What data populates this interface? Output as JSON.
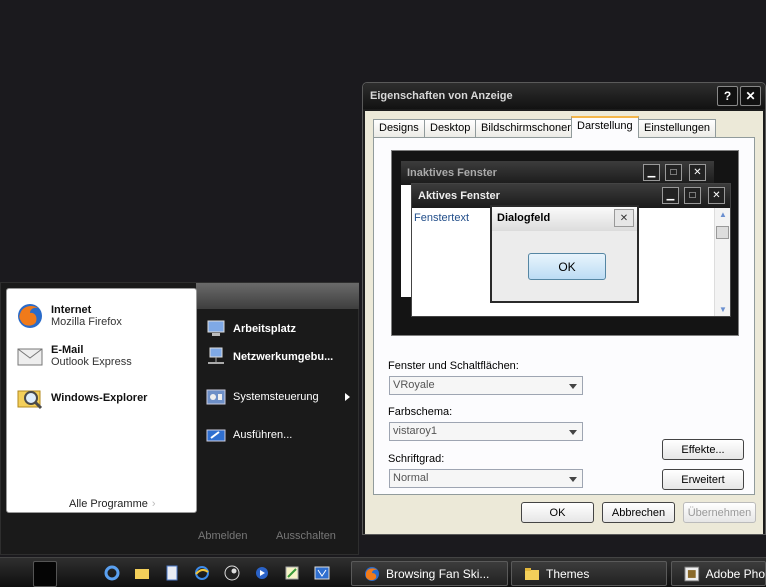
{
  "start_menu": {
    "pinned": [
      {
        "title": "Internet",
        "subtitle": "Mozilla Firefox",
        "icon": "firefox-icon"
      },
      {
        "title": "E-Mail",
        "subtitle": "Outlook Express",
        "icon": "mail-icon"
      },
      {
        "title": "Windows-Explorer",
        "subtitle": "",
        "icon": "explorer-icon"
      }
    ],
    "all_programs": "Alle Programme",
    "right_items": [
      {
        "label": "Arbeitsplatz",
        "icon": "computer-icon"
      },
      {
        "label": "Netzwerkumgebu...",
        "icon": "network-icon"
      },
      {
        "label": "Systemsteuerung",
        "icon": "control-panel-icon"
      },
      {
        "label": "Ausführen...",
        "icon": "run-icon"
      }
    ],
    "logoff": "Abmelden",
    "shutdown": "Ausschalten"
  },
  "dialog": {
    "title": "Eigenschaften von Anzeige",
    "help_btn": "?",
    "close_btn": "✕",
    "tabs": [
      "Designs",
      "Desktop",
      "Bildschirmschoner",
      "Darstellung",
      "Einstellungen"
    ],
    "active_tab": "Darstellung",
    "preview": {
      "inactive_title": "Inaktives Fenster",
      "active_title": "Aktives Fenster",
      "window_text": "Fenstertext",
      "msgbox_title": "Dialogfeld",
      "msgbox_ok": "OK"
    },
    "fields": {
      "windows_label": "Fenster und Schaltflächen:",
      "windows_value": "VRoyale",
      "scheme_label": "Farbschema:",
      "scheme_value": "vistaroy1",
      "font_label": "Schriftgrad:",
      "font_value": "Normal"
    },
    "effects_btn": "Effekte...",
    "advanced_btn": "Erweitert",
    "ok_btn": "OK",
    "cancel_btn": "Abbrechen",
    "apply_btn": "Übernehmen"
  },
  "taskbar": {
    "tasks": [
      {
        "label": "Browsing Fan Ski...",
        "icon": "firefox-icon"
      },
      {
        "label": "Themes",
        "icon": "folder-icon"
      },
      {
        "label": "Adobe Pho",
        "icon": "photoshop-icon"
      }
    ]
  },
  "colors": {
    "accent_tab": "#f4b64a",
    "dark_chrome": "#1c1c1c",
    "dialog_face": "#ece9d8"
  }
}
